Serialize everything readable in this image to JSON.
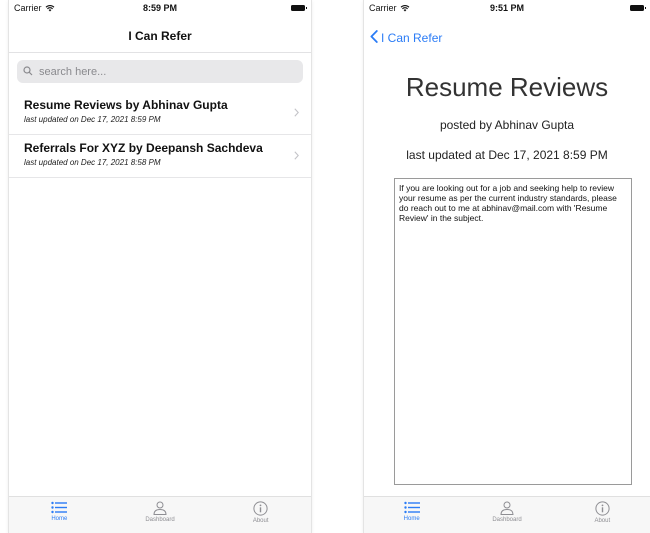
{
  "left_screen": {
    "status": {
      "carrier": "Carrier",
      "time": "8:59 PM"
    },
    "nav_title": "I Can Refer",
    "search": {
      "placeholder": "search here...",
      "value": ""
    },
    "items": [
      {
        "title": "Resume Reviews by Abhinav Gupta",
        "subtitle": "last updated on Dec 17, 2021 8:59 PM"
      },
      {
        "title": "Referrals For XYZ by Deepansh Sachdeva",
        "subtitle": "last updated on Dec 17, 2021 8:58 PM"
      }
    ],
    "tabs": [
      {
        "label": "Home",
        "icon": "list-icon",
        "active": true
      },
      {
        "label": "Dashboard",
        "icon": "person-icon",
        "active": false
      },
      {
        "label": "About",
        "icon": "info-icon",
        "active": false
      }
    ]
  },
  "right_screen": {
    "status": {
      "carrier": "Carrier",
      "time": "9:51 PM"
    },
    "back_label": "I Can Refer",
    "title": "Resume Reviews",
    "posted_by": "posted by Abhinav Gupta",
    "updated": "last updated at Dec 17, 2021 8:59 PM",
    "body": "If you are looking out for a job and seeking help to review your resume as per the current industry standards, please do reach out to me at abhinav@mail.com with 'Resume Review' in the subject.",
    "tabs": [
      {
        "label": "Home",
        "icon": "list-icon",
        "active": true
      },
      {
        "label": "Dashboard",
        "icon": "person-icon",
        "active": false
      },
      {
        "label": "About",
        "icon": "info-icon",
        "active": false
      }
    ]
  },
  "colors": {
    "accent": "#2b7cf6",
    "inactive": "#8e8e93"
  }
}
